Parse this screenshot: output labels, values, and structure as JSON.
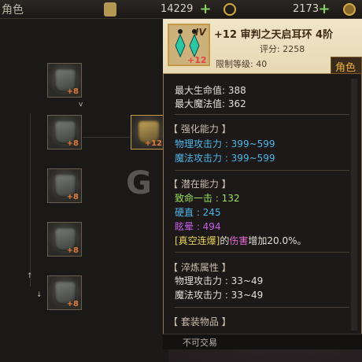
{
  "header": {
    "title": "角色",
    "currency1_value": "14229",
    "currency2_value": "2173",
    "plus_glyph": "+"
  },
  "inventory": {
    "slots": [
      {
        "plus": "+8"
      },
      {
        "plus": "+8"
      },
      {
        "plus": "+8"
      },
      {
        "plus": "+8"
      },
      {
        "plus": "+8"
      },
      {
        "plus": "+12"
      }
    ],
    "v_marker": "v"
  },
  "tooltip": {
    "item_tier": "IV",
    "item_plus": "+12",
    "item_name": "+12 审判之天启耳环 4阶",
    "score": "评分: 2258",
    "limit_level": "限制等级: 40",
    "role_tab": "角色",
    "stats_top": [
      "最大生命值: 388",
      "最大魔法值: 362"
    ],
    "sections": {
      "strength_title": "【 强化能力 】",
      "strength_lines": [
        "物理攻击力 : 399~599",
        "魔法攻击力 : 399~599"
      ],
      "potential_title": "【 潜在能力 】",
      "potential_lines": [
        "致命一击 : 132",
        "硬直 : 245",
        "眩晕 : 494"
      ],
      "skill_name": "[真空连爆]",
      "skill_mid": "的",
      "skill_dmg": "伤害",
      "skill_rest": "增加20.0%。",
      "temper_title": "【 淬炼属性 】",
      "temper_lines": [
        "物理攻击力 : 33~49",
        "魔法攻击力 : 33~49"
      ],
      "set_title": "【 套装物品 】"
    },
    "footer": "不可交易"
  },
  "colors": {
    "gold": "#d6a943",
    "cyan": "#4fb6e8",
    "green": "#9be061",
    "purple": "#c65de8",
    "yellow": "#e6d25a"
  },
  "watermark": "G"
}
